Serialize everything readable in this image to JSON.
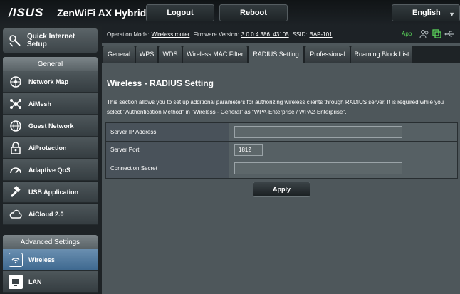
{
  "header": {
    "logo": "/ISUS",
    "model": "ZenWiFi AX Hybrid",
    "logout_label": "Logout",
    "reboot_label": "Reboot",
    "language": "English"
  },
  "sidebar": {
    "quick_setup": "Quick Internet Setup",
    "general_header": "General",
    "general_items": [
      {
        "label": "Network Map",
        "icon": "network-map-icon"
      },
      {
        "label": "AiMesh",
        "icon": "aimesh-icon"
      },
      {
        "label": "Guest Network",
        "icon": "guest-network-icon"
      },
      {
        "label": "AiProtection",
        "icon": "lock-icon"
      },
      {
        "label": "Adaptive QoS",
        "icon": "gauge-icon"
      },
      {
        "label": "USB Application",
        "icon": "usb-icon"
      },
      {
        "label": "AiCloud 2.0",
        "icon": "cloud-icon"
      }
    ],
    "advanced_header": "Advanced Settings",
    "advanced_items": [
      {
        "label": "Wireless",
        "icon": "wifi-icon",
        "active": true
      },
      {
        "label": "LAN",
        "icon": "lan-icon",
        "active": false
      }
    ]
  },
  "status": {
    "op_mode_label": "Operation Mode:",
    "op_mode_value": "Wireless router",
    "fw_label": "Firmware Version:",
    "fw_value": "3.0.0.4.386_43105",
    "ssid_label": "SSID:",
    "ssid_value": "BAP-101",
    "app_label": "App"
  },
  "tabs": [
    {
      "label": "General",
      "active": false
    },
    {
      "label": "WPS",
      "active": false
    },
    {
      "label": "WDS",
      "active": false
    },
    {
      "label": "Wireless MAC Filter",
      "active": false
    },
    {
      "label": "RADIUS Setting",
      "active": true
    },
    {
      "label": "Professional",
      "active": false
    },
    {
      "label": "Roaming Block List",
      "active": false
    }
  ],
  "page": {
    "title": "Wireless - RADIUS Setting",
    "description": "This section allows you to set up additional parameters for authorizing wireless clients through RADIUS server. It is required while you select \"Authentication Method\" in \"Wireless - General\" as \"WPA-Enterprise / WPA2-Enterprise\".",
    "fields": [
      {
        "label": "Server IP Address",
        "value": ""
      },
      {
        "label": "Server Port",
        "value": "1812"
      },
      {
        "label": "Connection Secret",
        "value": ""
      }
    ],
    "apply_label": "Apply"
  },
  "colors": {
    "accent_green": "#5bd55b",
    "active_menu": "#3f6990",
    "panel": "#4e575b"
  }
}
